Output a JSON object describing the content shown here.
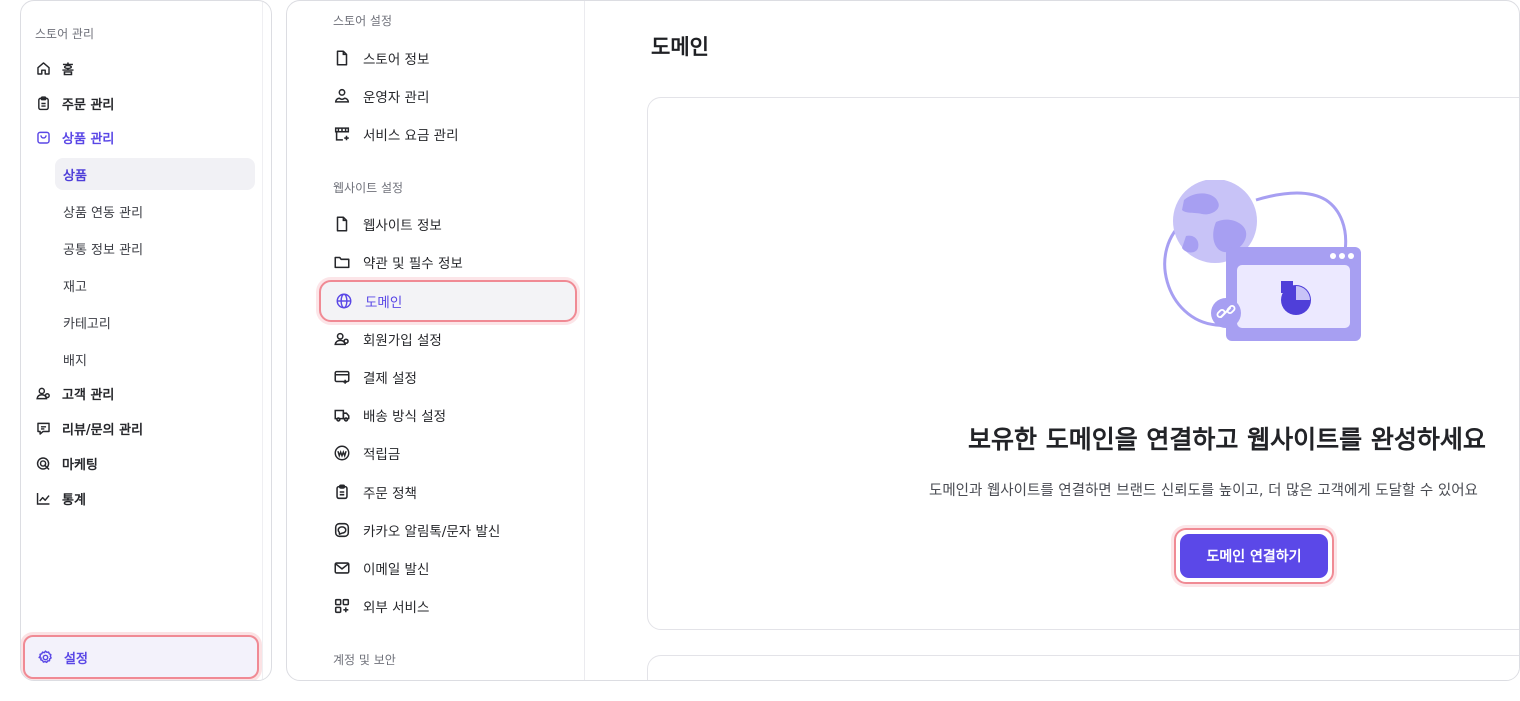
{
  "sidebar": {
    "section_label": "스토어 관리",
    "items": [
      {
        "label": "홈",
        "icon": "home-icon"
      },
      {
        "label": "주문 관리",
        "icon": "clipboard-icon"
      },
      {
        "label": "상품 관리",
        "icon": "shopping-bag-icon",
        "active": true
      }
    ],
    "product_subitems": [
      "상품",
      "상품 연동 관리",
      "공통 정보 관리",
      "재고",
      "카테고리",
      "배지"
    ],
    "items_after": [
      {
        "label": "고객 관리",
        "icon": "users-icon"
      },
      {
        "label": "리뷰/문의 관리",
        "icon": "chat-icon"
      },
      {
        "label": "마케팅",
        "icon": "target-icon"
      },
      {
        "label": "통계",
        "icon": "chart-icon"
      }
    ],
    "settings_label": "설정"
  },
  "sub_nav": {
    "store_section": "스토어 설정",
    "store_items": [
      "스토어 정보",
      "운영자 관리",
      "서비스 요금 관리"
    ],
    "website_section": "웹사이트 설정",
    "website_items": [
      "웹사이트 정보",
      "약관 및 필수 정보",
      "도메인",
      "회원가입 설정",
      "결제 설정",
      "배송 방식 설정",
      "적립금",
      "주문 정책",
      "카카오 알림톡/문자 발신",
      "이메일 발신",
      "외부 서비스"
    ],
    "account_section": "계정 및 보안"
  },
  "content": {
    "title": "도메인",
    "headline": "보유한 도메인을 연결하고 웹사이트를 완성하세요",
    "description": "도메인과 웹사이트를 연결하면 브랜드 신뢰도를 높이고, 더 많은 고객에게 도달할 수 있어요",
    "cta_label": "도메인 연결하기"
  },
  "colors": {
    "accent": "#5b48e8",
    "highlight_ring": "#f08a94",
    "illustration_light": "#c8c3f7",
    "illustration_mid": "#a79ff2"
  }
}
